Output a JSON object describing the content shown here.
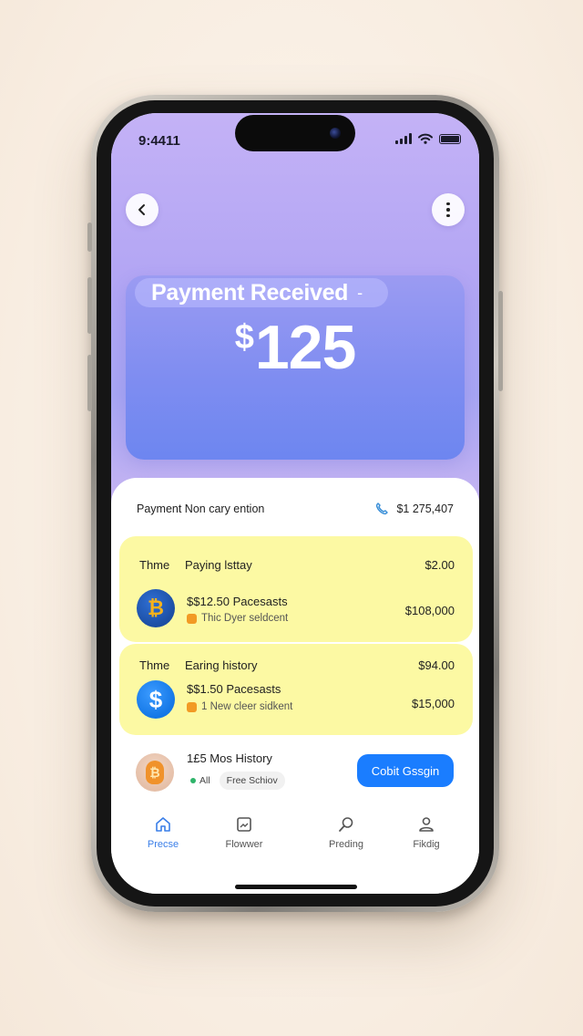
{
  "status_bar": {
    "time": "9:4411"
  },
  "header": {
    "back_icon": "chevron-left-icon",
    "more_icon": "vertical-dots-icon"
  },
  "payment_card": {
    "label": "Payment Received",
    "currency": "$",
    "amount": "125"
  },
  "notice": {
    "text": "Payment Non cary ention",
    "icon": "phone-icon",
    "amount": "$1 275,407"
  },
  "history_cards": [
    {
      "col1": "Thme",
      "col2": "Paying lsttay",
      "col3": "$2.00",
      "coin": "bitcoin-icon",
      "coin_glyph": "₿",
      "title": "$$12.50 Pacesasts",
      "subtitle": "Thic Dyer seldcent",
      "value": "$108,000",
      "background": "#fcf9a3"
    },
    {
      "col1": "Thme",
      "col2": "Earing history",
      "col3": "$94.00",
      "coin": "dollar-coin-icon",
      "coin_glyph": "$",
      "title": "$$1.50 Pacesasts",
      "subtitle": "1 New cleer sidkent",
      "value": "$15,000",
      "background": "#fcf9a3"
    }
  ],
  "footer": {
    "title": "1£5 Mos History",
    "chip_all": "All",
    "chip_free": "Free Schiov",
    "cta_label": "Cobit Gssgin",
    "cta_color": "#1a7dff"
  },
  "tabs": [
    {
      "label": "Precse",
      "icon": "home-icon",
      "active": true
    },
    {
      "label": "Flowwer",
      "icon": "gallery-icon",
      "active": false
    },
    {
      "label": "Preding",
      "icon": "search-icon",
      "active": false
    },
    {
      "label": "Fikdig",
      "icon": "profile-icon",
      "active": false
    }
  ],
  "colors": {
    "accent": "#3a7ee8",
    "hero_top": "#c4b2f6",
    "card": "#7f8df1"
  }
}
